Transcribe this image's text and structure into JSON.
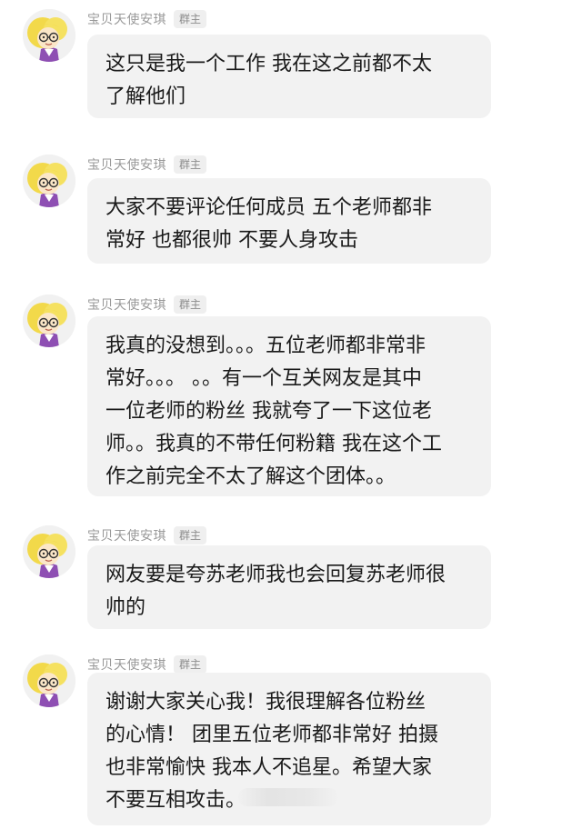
{
  "chat": {
    "messages": [
      {
        "sender": "宝贝天使安琪",
        "role_badge": "群主",
        "lines": [
          "这只是我一个工作 我在这之前都不太",
          "了解他们"
        ]
      },
      {
        "sender": "宝贝天使安琪",
        "role_badge": "群主",
        "lines": [
          "大家不要评论任何成员 五个老师都非",
          "常好 也都很帅 不要人身攻击"
        ]
      },
      {
        "sender": "宝贝天使安琪",
        "role_badge": "群主",
        "lines": [
          "我真的没想到。。。五位老师都非常非",
          "常好。。。 。。有一个互关网友是其中",
          "一位老师的粉丝 我就夸了一下这位老",
          "师。。我真的不带任何粉籍 我在这个工",
          "作之前完全不太了解这个团体。。"
        ]
      },
      {
        "sender": "宝贝天使安琪",
        "role_badge": "群主",
        "lines": [
          "网友要是夸苏老师我也会回复苏老师很",
          "帅的"
        ]
      },
      {
        "sender": "宝贝天使安琪",
        "role_badge": "群主",
        "lines": [
          "谢谢大家关心我！我很理解各位粉丝",
          "的心情！ 团里五位老师都非常好 拍摄",
          "也非常愉快 我本人不追星。希望大家",
          "不要互相攻击。"
        ]
      }
    ]
  },
  "avatar_icon": "cartoon-girl-with-glasses-avatar"
}
